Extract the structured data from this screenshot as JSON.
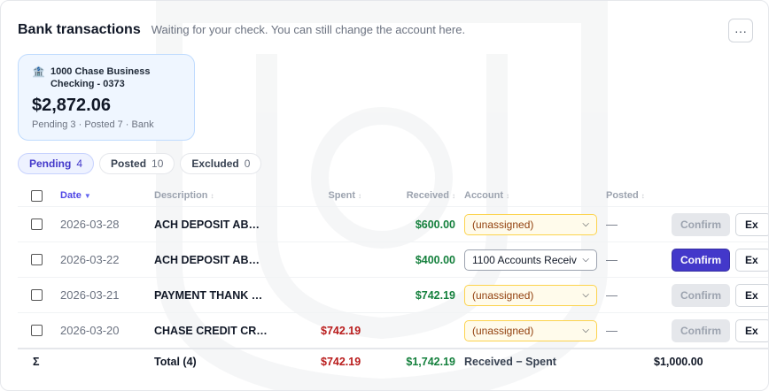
{
  "header": {
    "title": "Bank transactions",
    "subtitle": "Waiting for your check. You can still change the account here.",
    "more_label": "···"
  },
  "account": {
    "name": "1000 Chase Business Checking - 0373",
    "balance": "$2,872.06",
    "meta": "Pending 3 · Posted 7 · Bank"
  },
  "tabs": [
    {
      "label": "Pending",
      "count": "4"
    },
    {
      "label": "Posted",
      "count": "10"
    },
    {
      "label": "Excluded",
      "count": "0"
    }
  ],
  "columns": {
    "date": "Date",
    "description": "Description",
    "spent": "Spent",
    "received": "Received",
    "account": "Account",
    "posted": "Posted"
  },
  "rows": [
    {
      "date": "2026-03-28",
      "description": "ACH DEPOSIT AB…",
      "spent": "",
      "received": "$600.00",
      "account": "(unassigned)",
      "posted": "—",
      "confirm": "Confirm",
      "exclude": "Ex"
    },
    {
      "date": "2026-03-22",
      "description": "ACH DEPOSIT AB…",
      "spent": "",
      "received": "$400.00",
      "account": "1100 Accounts Receiv",
      "posted": "—",
      "confirm": "Confirm",
      "exclude": "Ex"
    },
    {
      "date": "2026-03-21",
      "description": "PAYMENT THANK …",
      "spent": "",
      "received": "$742.19",
      "account": "(unassigned)",
      "posted": "—",
      "confirm": "Confirm",
      "exclude": "Ex"
    },
    {
      "date": "2026-03-20",
      "description": "CHASE CREDIT CR…",
      "spent": "$742.19",
      "received": "",
      "account": "(unassigned)",
      "posted": "—",
      "confirm": "Confirm",
      "exclude": "Ex"
    }
  ],
  "totals": {
    "sigma": "Σ",
    "label": "Total (4)",
    "spent": "$742.19",
    "received": "$1,742.19",
    "formula": "Received − Spent",
    "difference": "$1,000.00"
  },
  "colors": {
    "accent": "#4338ca",
    "positive": "#15803d",
    "negative": "#b91c1c",
    "unassigned_bg": "#fffbeb"
  }
}
